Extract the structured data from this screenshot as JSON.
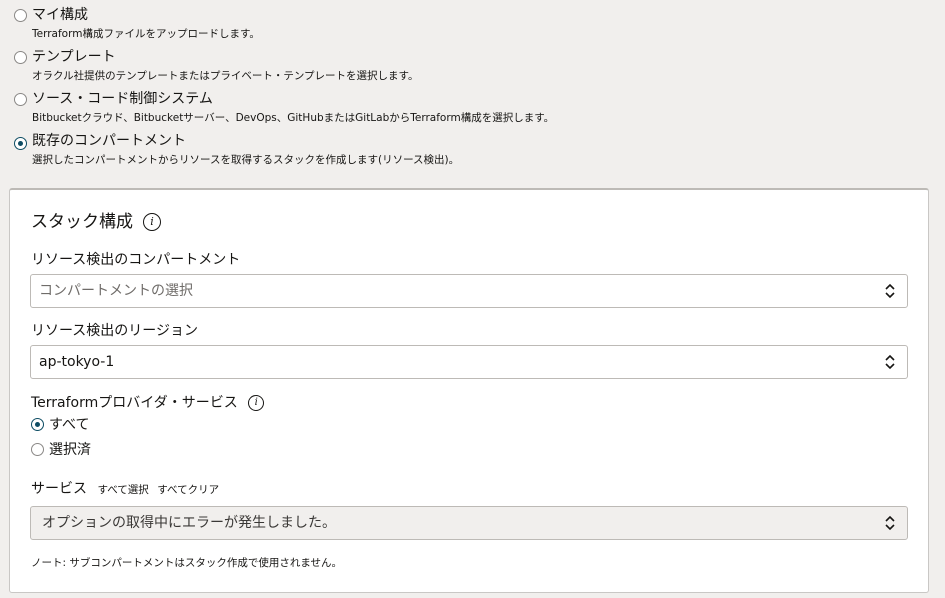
{
  "origins": [
    {
      "title": "マイ構成",
      "desc": "Terraform構成ファイルをアップロードします。",
      "selected": false
    },
    {
      "title": "テンプレート",
      "desc": "オラクル社提供のテンプレートまたはプライベート・テンプレートを選択します。",
      "selected": false
    },
    {
      "title": "ソース・コード制御システム",
      "desc": "Bitbucketクラウド、Bitbucketサーバー、DevOps、GitHubまたはGitLabからTerraform構成を選択します。",
      "selected": false
    },
    {
      "title": "既存のコンパートメント",
      "desc": "選択したコンパートメントからリソースを取得するスタックを作成します(リソース検出)。",
      "selected": true
    }
  ],
  "panel": {
    "title": "スタック構成",
    "title_icon": "info-icon",
    "compartment": {
      "label": "リソース検出のコンパートメント",
      "placeholder": "コンパートメントの選択"
    },
    "region": {
      "label": "リソース検出のリージョン",
      "value": "ap-tokyo-1"
    },
    "provider": {
      "label": "Terraformプロバイダ・サービス",
      "icon": "info-icon",
      "options": [
        {
          "label": "すべて",
          "selected": true
        },
        {
          "label": "選択済",
          "selected": false
        }
      ]
    },
    "services": {
      "label": "サービス",
      "select_all": "すべて選択",
      "clear_all": "すべてクリア",
      "value": "オプションの取得中にエラーが発生しました。"
    },
    "note": "ノート: サブコンパートメントはスタック作成で使用されません。"
  },
  "colors": {
    "accent": "#227e9e",
    "page_bg": "#f1efed"
  }
}
